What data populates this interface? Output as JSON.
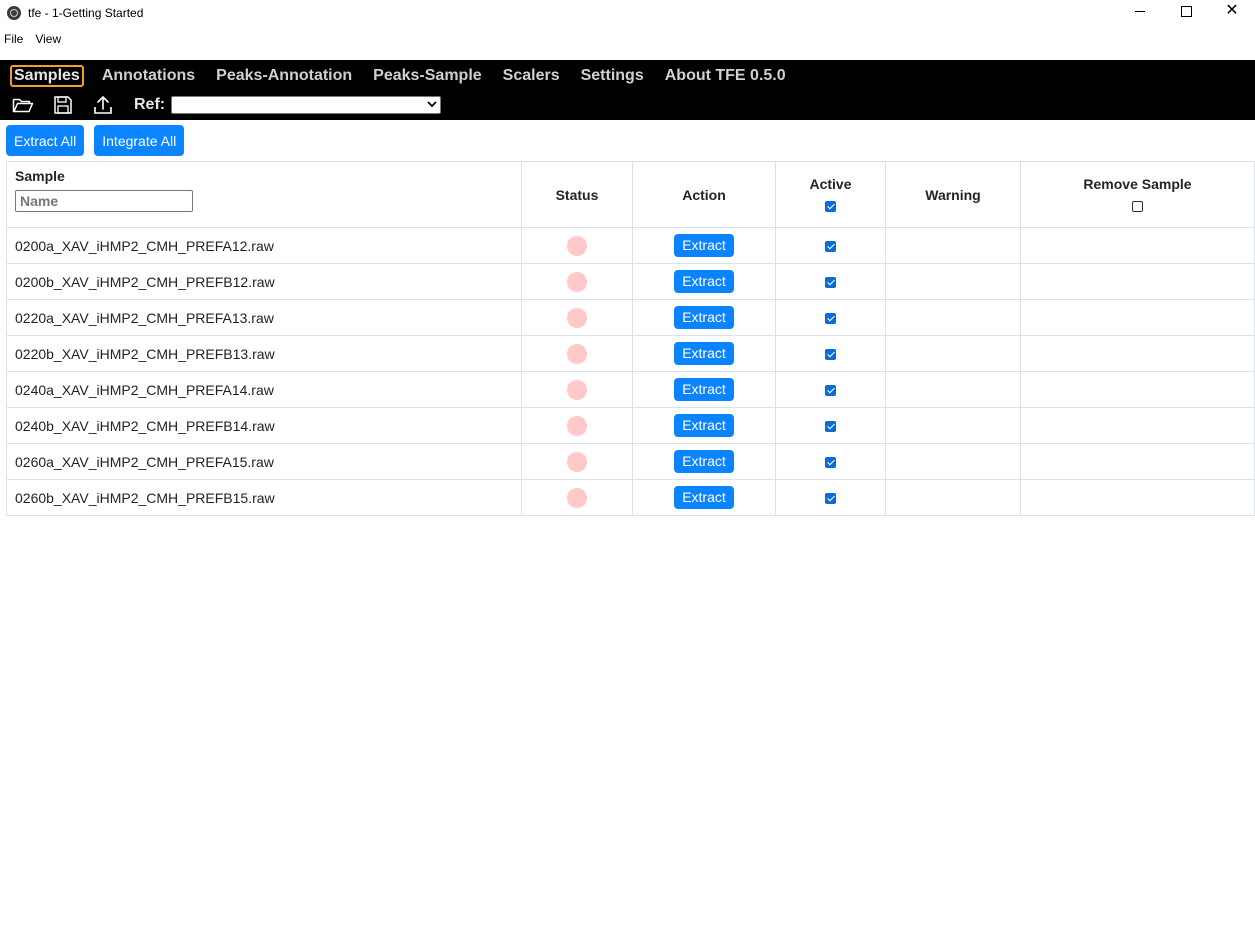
{
  "window": {
    "title": "tfe - 1-Getting Started"
  },
  "menu": [
    "File",
    "View"
  ],
  "nav": {
    "tabs": [
      {
        "label": "Samples",
        "active": true
      },
      {
        "label": "Annotations",
        "active": false
      },
      {
        "label": "Peaks-Annotation",
        "active": false
      },
      {
        "label": "Peaks-Sample",
        "active": false
      },
      {
        "label": "Scalers",
        "active": false
      },
      {
        "label": "Settings",
        "active": false
      },
      {
        "label": "About TFE 0.5.0",
        "active": false
      }
    ],
    "accent": "#f0a028"
  },
  "toolbar": {
    "icons": [
      "folder-open-icon",
      "save-icon",
      "upload-icon"
    ],
    "ref_label": "Ref:",
    "ref_value": ""
  },
  "actions": {
    "extract_all": "Extract All",
    "integrate_all": "Integrate All"
  },
  "table": {
    "headers": {
      "sample": "Sample",
      "status": "Status",
      "action": "Action",
      "active": "Active",
      "warning": "Warning",
      "remove": "Remove Sample"
    },
    "name_placeholder": "Name",
    "active_all_checked": true,
    "remove_all_checked": false,
    "rows": [
      {
        "sample": "0200a_XAV_iHMP2_CMH_PREFA12.raw",
        "action": "Extract",
        "active": true,
        "warning": ""
      },
      {
        "sample": "0200b_XAV_iHMP2_CMH_PREFB12.raw",
        "action": "Extract",
        "active": true,
        "warning": ""
      },
      {
        "sample": "0220a_XAV_iHMP2_CMH_PREFA13.raw",
        "action": "Extract",
        "active": true,
        "warning": ""
      },
      {
        "sample": "0220b_XAV_iHMP2_CMH_PREFB13.raw",
        "action": "Extract",
        "active": true,
        "warning": ""
      },
      {
        "sample": "0240a_XAV_iHMP2_CMH_PREFA14.raw",
        "action": "Extract",
        "active": true,
        "warning": ""
      },
      {
        "sample": "0240b_XAV_iHMP2_CMH_PREFB14.raw",
        "action": "Extract",
        "active": true,
        "warning": ""
      },
      {
        "sample": "0260a_XAV_iHMP2_CMH_PREFA15.raw",
        "action": "Extract",
        "active": true,
        "warning": ""
      },
      {
        "sample": "0260b_XAV_iHMP2_CMH_PREFB15.raw",
        "action": "Extract",
        "active": true,
        "warning": ""
      }
    ]
  },
  "colors": {
    "primary": "#0a84ff",
    "status_idle": "#ffc9c9",
    "header_bg": "#000000"
  }
}
